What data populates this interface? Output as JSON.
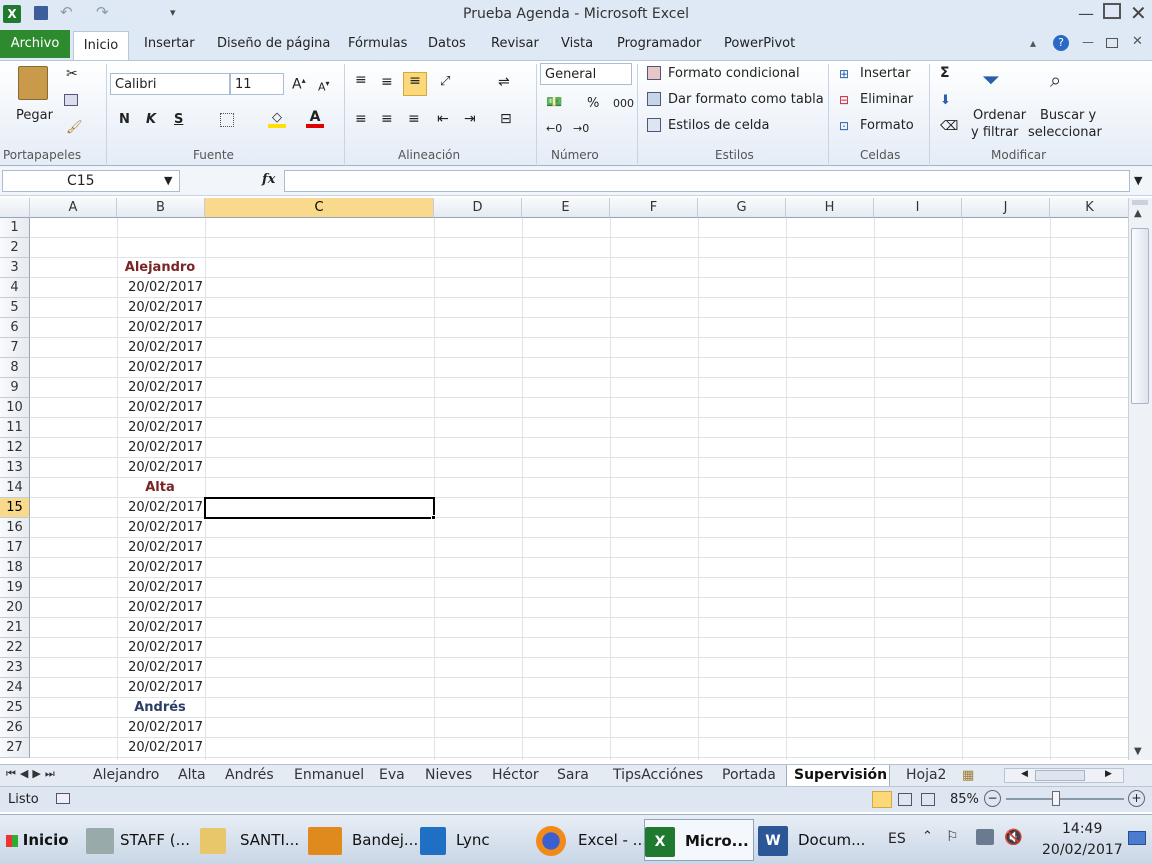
{
  "window": {
    "title": "Prueba Agenda  -  Microsoft Excel"
  },
  "tabs": {
    "archivo": "Archivo",
    "items": [
      "Inicio",
      "Insertar",
      "Diseño de página",
      "Fórmulas",
      "Datos",
      "Revisar",
      "Vista",
      "Programador",
      "PowerPivot"
    ]
  },
  "ribbon": {
    "paste": "Pegar",
    "font_name": "Calibri",
    "font_size": "11",
    "bold": "N",
    "italic": "K",
    "underline": "S",
    "number_format": "General",
    "percent": "%",
    "thousands": "000",
    "formato_condicional": "Formato condicional",
    "dar_formato_tabla": "Dar formato como tabla",
    "estilos_celda": "Estilos de celda",
    "insertar": "Insertar",
    "eliminar": "Eliminar",
    "formato": "Formato",
    "sigma": "Σ",
    "ordenar_1": "Ordenar",
    "ordenar_2": "y filtrar",
    "buscar_1": "Buscar y",
    "buscar_2": "seleccionar",
    "groups": {
      "portapapeles": "Portapapeles",
      "fuente": "Fuente",
      "alineacion": "Alineación",
      "numero": "Número",
      "estilos": "Estilos",
      "celdas": "Celdas",
      "modificar": "Modificar"
    }
  },
  "formula_bar": {
    "name_box": "C15",
    "fx": "fx",
    "value": ""
  },
  "grid": {
    "columns": [
      "A",
      "B",
      "C",
      "D",
      "E",
      "F",
      "G",
      "H",
      "I",
      "J",
      "K"
    ],
    "selected_column": "C",
    "selected_row": "15",
    "rows": [
      {
        "n": "1",
        "b": "",
        "type": "empty"
      },
      {
        "n": "2",
        "b": "",
        "type": "empty"
      },
      {
        "n": "3",
        "b": "Alejandro",
        "type": "header"
      },
      {
        "n": "4",
        "b": "20/02/2017",
        "type": "date"
      },
      {
        "n": "5",
        "b": "20/02/2017",
        "type": "date"
      },
      {
        "n": "6",
        "b": "20/02/2017",
        "type": "date"
      },
      {
        "n": "7",
        "b": "20/02/2017",
        "type": "date"
      },
      {
        "n": "8",
        "b": "20/02/2017",
        "type": "date"
      },
      {
        "n": "9",
        "b": "20/02/2017",
        "type": "date"
      },
      {
        "n": "10",
        "b": "20/02/2017",
        "type": "date"
      },
      {
        "n": "11",
        "b": "20/02/2017",
        "type": "date"
      },
      {
        "n": "12",
        "b": "20/02/2017",
        "type": "date"
      },
      {
        "n": "13",
        "b": "20/02/2017",
        "type": "date"
      },
      {
        "n": "14",
        "b": "Alta",
        "type": "header"
      },
      {
        "n": "15",
        "b": "20/02/2017",
        "type": "date"
      },
      {
        "n": "16",
        "b": "20/02/2017",
        "type": "date"
      },
      {
        "n": "17",
        "b": "20/02/2017",
        "type": "date"
      },
      {
        "n": "18",
        "b": "20/02/2017",
        "type": "date"
      },
      {
        "n": "19",
        "b": "20/02/2017",
        "type": "date"
      },
      {
        "n": "20",
        "b": "20/02/2017",
        "type": "date"
      },
      {
        "n": "21",
        "b": "20/02/2017",
        "type": "date"
      },
      {
        "n": "22",
        "b": "20/02/2017",
        "type": "date"
      },
      {
        "n": "23",
        "b": "20/02/2017",
        "type": "date"
      },
      {
        "n": "24",
        "b": "20/02/2017",
        "type": "date"
      },
      {
        "n": "25",
        "b": "Andrés",
        "type": "header2"
      },
      {
        "n": "26",
        "b": "20/02/2017",
        "type": "date"
      },
      {
        "n": "27",
        "b": "20/02/2017",
        "type": "date"
      }
    ]
  },
  "sheet_tabs": [
    "Alejandro",
    "Alta",
    "Andrés",
    "Enmanuel",
    "Eva",
    "Nieves",
    "Héctor",
    "Sara",
    "TipsAcciónes",
    "Portada",
    "Supervisión",
    "Hoja2"
  ],
  "active_sheet": "Supervisión",
  "status": {
    "ready": "Listo",
    "zoom": "85%"
  },
  "taskbar": {
    "start": "Inicio",
    "items": [
      "STAFF (...",
      "SANTI...",
      "Bandej...",
      "Lync",
      "Excel - ...",
      "Micro...",
      "Docum..."
    ],
    "lang": "ES",
    "time": "14:49",
    "date": "20/02/2017"
  }
}
